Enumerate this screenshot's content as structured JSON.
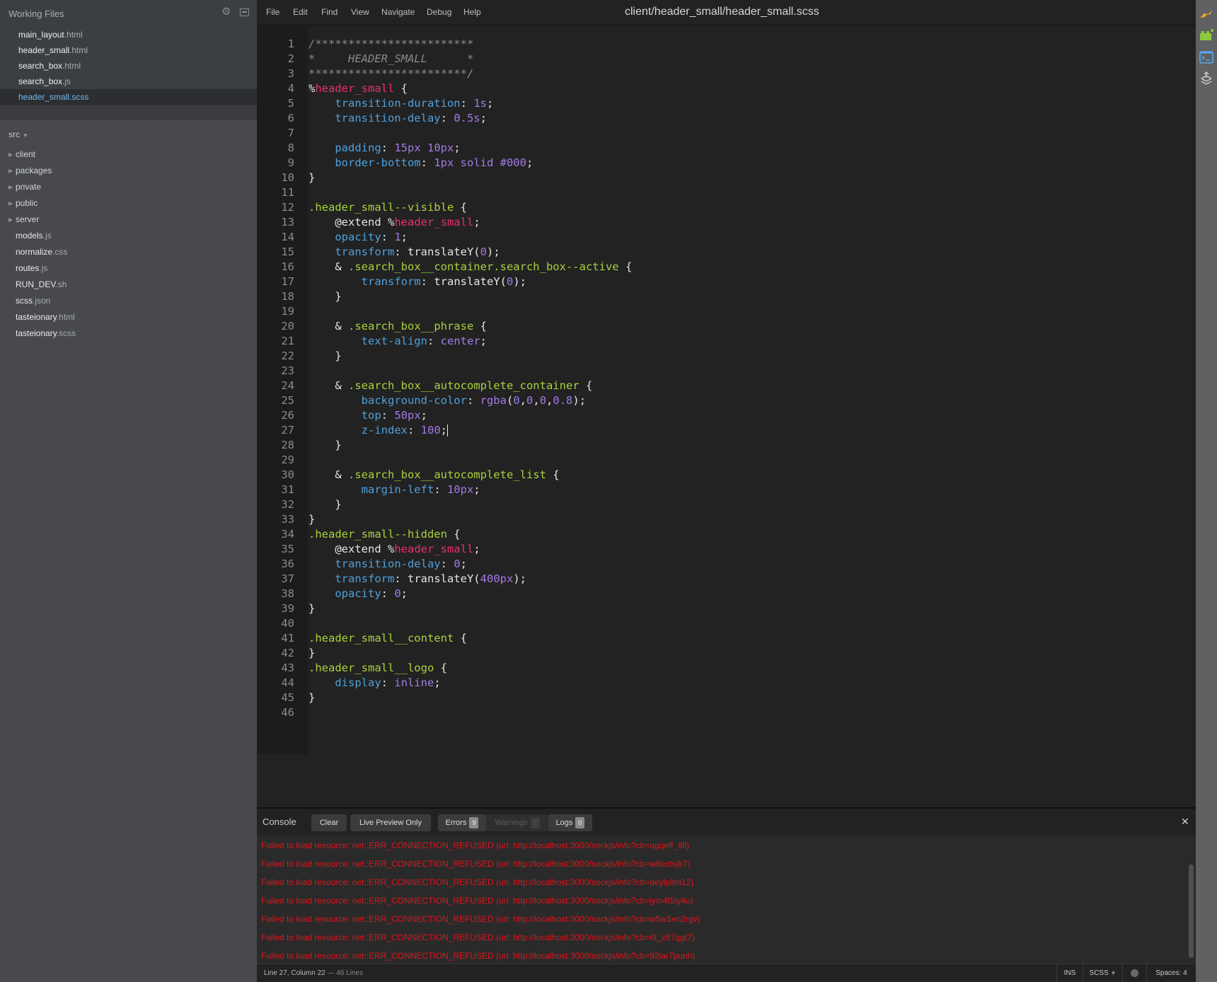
{
  "sidebar": {
    "working_files_title": "Working Files",
    "working_files": [
      {
        "name": "main_layout",
        "ext": ".html",
        "active": false
      },
      {
        "name": "header_small",
        "ext": ".html",
        "active": false
      },
      {
        "name": "search_box",
        "ext": ".html",
        "active": false
      },
      {
        "name": "search_box",
        "ext": ".js",
        "active": false
      },
      {
        "name": "header_small",
        "ext": ".scss",
        "active": true
      }
    ],
    "project_root": "src",
    "tree": [
      {
        "name": "client",
        "ext": "",
        "type": "folder"
      },
      {
        "name": "packages",
        "ext": "",
        "type": "folder"
      },
      {
        "name": "private",
        "ext": "",
        "type": "folder"
      },
      {
        "name": "public",
        "ext": "",
        "type": "folder"
      },
      {
        "name": "server",
        "ext": "",
        "type": "folder"
      },
      {
        "name": "models",
        "ext": ".js",
        "type": "file"
      },
      {
        "name": "normalize",
        "ext": ".css",
        "type": "file"
      },
      {
        "name": "routes",
        "ext": ".js",
        "type": "file"
      },
      {
        "name": "RUN_DEV",
        "ext": ".sh",
        "type": "file"
      },
      {
        "name": "scss",
        "ext": ".json",
        "type": "file"
      },
      {
        "name": "tasteionary",
        "ext": ".html",
        "type": "file"
      },
      {
        "name": "tasteionary",
        "ext": ".scss",
        "type": "file"
      }
    ]
  },
  "menu": [
    "File",
    "Edit",
    "Find",
    "View",
    "Navigate",
    "Debug",
    "Help"
  ],
  "editor": {
    "title": "client/header_small/header_small.scss",
    "cursor": {
      "line": 27,
      "column": 22
    },
    "lines": [
      [
        [
          "com",
          "/************************"
        ]
      ],
      [
        [
          "com",
          "*     HEADER_SMALL      *"
        ]
      ],
      [
        [
          "com",
          "************************/"
        ]
      ],
      [
        [
          "pun",
          "%"
        ],
        [
          "ph",
          "header_small"
        ],
        [
          "pun",
          " {"
        ]
      ],
      [
        [
          "pun",
          "    "
        ],
        [
          "prop",
          "transition-duration"
        ],
        [
          "pun",
          ": "
        ],
        [
          "num",
          "1s"
        ],
        [
          "pun",
          ";"
        ]
      ],
      [
        [
          "pun",
          "    "
        ],
        [
          "prop",
          "transition-delay"
        ],
        [
          "pun",
          ": "
        ],
        [
          "num",
          "0.5s"
        ],
        [
          "pun",
          ";"
        ]
      ],
      [],
      [
        [
          "pun",
          "    "
        ],
        [
          "prop",
          "padding"
        ],
        [
          "pun",
          ": "
        ],
        [
          "num",
          "15px 10px"
        ],
        [
          "pun",
          ";"
        ]
      ],
      [
        [
          "pun",
          "    "
        ],
        [
          "prop",
          "border-bottom"
        ],
        [
          "pun",
          ": "
        ],
        [
          "num",
          "1px solid #000"
        ],
        [
          "pun",
          ";"
        ]
      ],
      [
        [
          "pun",
          "}"
        ]
      ],
      [],
      [
        [
          "sel",
          ".header_small--visible"
        ],
        [
          "pun",
          " {"
        ]
      ],
      [
        [
          "pun",
          "    @extend %"
        ],
        [
          "ph",
          "header_small"
        ],
        [
          "pun",
          ";"
        ]
      ],
      [
        [
          "pun",
          "    "
        ],
        [
          "prop",
          "opacity"
        ],
        [
          "pun",
          ": "
        ],
        [
          "num",
          "1"
        ],
        [
          "pun",
          ";"
        ]
      ],
      [
        [
          "pun",
          "    "
        ],
        [
          "prop",
          "transform"
        ],
        [
          "pun",
          ": translateY("
        ],
        [
          "num",
          "0"
        ],
        [
          "pun",
          ");"
        ]
      ],
      [
        [
          "pun",
          "    & "
        ],
        [
          "sel",
          ".search_box__container.search_box--active"
        ],
        [
          "pun",
          " {"
        ]
      ],
      [
        [
          "pun",
          "        "
        ],
        [
          "prop",
          "transform"
        ],
        [
          "pun",
          ": translateY("
        ],
        [
          "num",
          "0"
        ],
        [
          "pun",
          ");"
        ]
      ],
      [
        [
          "pun",
          "    }"
        ]
      ],
      [],
      [
        [
          "pun",
          "    & "
        ],
        [
          "sel",
          ".search_box__phrase"
        ],
        [
          "pun",
          " {"
        ]
      ],
      [
        [
          "pun",
          "        "
        ],
        [
          "prop",
          "text-align"
        ],
        [
          "pun",
          ": "
        ],
        [
          "num",
          "center"
        ],
        [
          "pun",
          ";"
        ]
      ],
      [
        [
          "pun",
          "    }"
        ]
      ],
      [],
      [
        [
          "pun",
          "    & "
        ],
        [
          "sel",
          ".search_box__autocomplete_container"
        ],
        [
          "pun",
          " {"
        ]
      ],
      [
        [
          "pun",
          "        "
        ],
        [
          "prop",
          "background-color"
        ],
        [
          "pun",
          ": "
        ],
        [
          "num",
          "rgba"
        ],
        [
          "pun",
          "("
        ],
        [
          "num",
          "0"
        ],
        [
          "pun",
          ","
        ],
        [
          "num",
          "0"
        ],
        [
          "pun",
          ","
        ],
        [
          "num",
          "0"
        ],
        [
          "pun",
          ","
        ],
        [
          "num",
          "0.8"
        ],
        [
          "pun",
          ");"
        ]
      ],
      [
        [
          "pun",
          "        "
        ],
        [
          "prop",
          "top"
        ],
        [
          "pun",
          ": "
        ],
        [
          "num",
          "50px"
        ],
        [
          "pun",
          ";"
        ]
      ],
      [
        [
          "pun",
          "        "
        ],
        [
          "prop",
          "z-index"
        ],
        [
          "pun",
          ": "
        ],
        [
          "num",
          "100"
        ],
        [
          "pun",
          ";"
        ],
        [
          "cursor",
          ""
        ]
      ],
      [
        [
          "pun",
          "    }"
        ]
      ],
      [],
      [
        [
          "pun",
          "    & "
        ],
        [
          "sel",
          ".search_box__autocomplete_list"
        ],
        [
          "pun",
          " {"
        ]
      ],
      [
        [
          "pun",
          "        "
        ],
        [
          "prop",
          "margin-left"
        ],
        [
          "pun",
          ": "
        ],
        [
          "num",
          "10px"
        ],
        [
          "pun",
          ";"
        ]
      ],
      [
        [
          "pun",
          "    }"
        ]
      ],
      [
        [
          "pun",
          "}"
        ]
      ],
      [
        [
          "sel",
          ".header_small--hidden"
        ],
        [
          "pun",
          " {"
        ]
      ],
      [
        [
          "pun",
          "    @extend %"
        ],
        [
          "ph",
          "header_small"
        ],
        [
          "pun",
          ";"
        ]
      ],
      [
        [
          "pun",
          "    "
        ],
        [
          "prop",
          "transition-delay"
        ],
        [
          "pun",
          ": "
        ],
        [
          "num",
          "0"
        ],
        [
          "pun",
          ";"
        ]
      ],
      [
        [
          "pun",
          "    "
        ],
        [
          "prop",
          "transform"
        ],
        [
          "pun",
          ": translateY("
        ],
        [
          "num",
          "400px"
        ],
        [
          "pun",
          ");"
        ]
      ],
      [
        [
          "pun",
          "    "
        ],
        [
          "prop",
          "opacity"
        ],
        [
          "pun",
          ": "
        ],
        [
          "num",
          "0"
        ],
        [
          "pun",
          ";"
        ]
      ],
      [
        [
          "pun",
          "}"
        ]
      ],
      [],
      [
        [
          "sel",
          ".header_small__content"
        ],
        [
          "pun",
          " {"
        ]
      ],
      [
        [
          "pun",
          "}"
        ]
      ],
      [
        [
          "sel",
          ".header_small__logo"
        ],
        [
          "pun",
          " {"
        ]
      ],
      [
        [
          "pun",
          "    "
        ],
        [
          "prop",
          "display"
        ],
        [
          "pun",
          ": "
        ],
        [
          "num",
          "inline"
        ],
        [
          "pun",
          ";"
        ]
      ],
      [
        [
          "pun",
          "}"
        ]
      ],
      []
    ]
  },
  "console": {
    "title": "Console",
    "clear_label": "Clear",
    "live_preview_label": "Live Preview Only",
    "errors_label": "Errors",
    "errors_count": "9",
    "warnings_label": "Warnings",
    "warnings_count": "0",
    "logs_label": "Logs",
    "logs_count": "0",
    "close_glyph": "✕",
    "messages": [
      "Failed to load resource: net::ERR_CONNECTION_REFUSED (url: http://localhost:3000/sockjs/info?cb=qgqeff_9ll)",
      "Failed to load resource: net::ERR_CONNECTION_REFUSED (url: http://localhost:3000/sockjs/info?cb=w6ectsjlr7)",
      "Failed to load resource: net::ERR_CONNECTION_REFUSED (url: http://localhost:3000/sockjs/info?cb=deylpltm12)",
      "Failed to load resource: net::ERR_CONNECTION_REFUSED (url: http://localhost:3000/sockjs/info?cb=jym4t5ly4u)",
      "Failed to load resource: net::ERR_CONNECTION_REFUSED (url: http://localhost:3000/sockjs/info?cb=w5w1en2rgv)",
      "Failed to load resource: net::ERR_CONNECTION_REFUSED (url: http://localhost:3000/sockjs/info?cb=6t_z87qgt7)",
      "Failed to load resource: net::ERR_CONNECTION_REFUSED (url: http://localhost:3000/sockjs/info?cb=92iar7punh)"
    ],
    "error_color": "#e0141b"
  },
  "statusbar": {
    "position": "Line 27, Column 22",
    "line_count": " — 46 Lines",
    "mode": "INS",
    "language": "SCSS",
    "indent": "Spaces: 4"
  },
  "right_toolbar": {
    "icons": [
      "live-preview-icon",
      "extension-manager-icon",
      "terminal-icon",
      "deploy-icon"
    ],
    "colors": {
      "live_preview": "#f5a623",
      "extensions": "#8dc63f",
      "terminal": "#5aa7f0",
      "deploy": "#cfcfcf"
    }
  }
}
